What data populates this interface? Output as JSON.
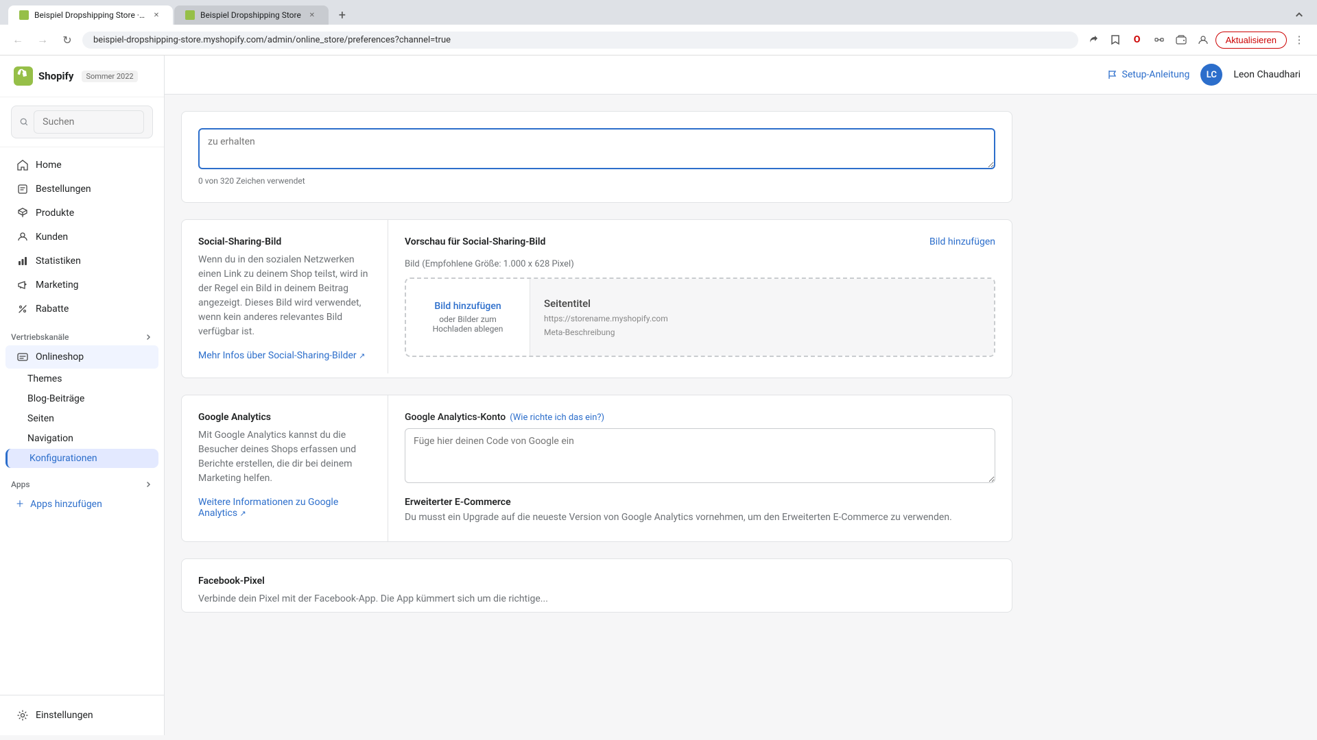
{
  "browser": {
    "tabs": [
      {
        "id": "tab1",
        "title": "Beispiel Dropshipping Store ·...",
        "active": true
      },
      {
        "id": "tab2",
        "title": "Beispiel Dropshipping Store",
        "active": false
      }
    ],
    "address": "beispiel-dropshipping-store.myshopify.com/admin/online_store/preferences?channel=true",
    "update_btn": "Aktualisieren"
  },
  "topbar": {
    "setup_label": "Setup-Anleitung",
    "user_initials": "LC",
    "user_name": "Leon Chaudhari"
  },
  "sidebar": {
    "logo": "Shopify",
    "season": "Sommer 2022",
    "search_placeholder": "Suchen",
    "nav_items": [
      {
        "id": "home",
        "label": "Home",
        "icon": "home"
      },
      {
        "id": "orders",
        "label": "Bestellungen",
        "icon": "orders"
      },
      {
        "id": "products",
        "label": "Produkte",
        "icon": "products"
      },
      {
        "id": "customers",
        "label": "Kunden",
        "icon": "customers"
      },
      {
        "id": "analytics",
        "label": "Statistiken",
        "icon": "analytics"
      },
      {
        "id": "marketing",
        "label": "Marketing",
        "icon": "marketing"
      },
      {
        "id": "discounts",
        "label": "Rabatte",
        "icon": "discounts"
      }
    ],
    "sales_channels_label": "Vertriebskanäle",
    "online_store_label": "Onlineshop",
    "sub_nav": [
      {
        "id": "themes",
        "label": "Themes"
      },
      {
        "id": "blog",
        "label": "Blog-Beiträge"
      },
      {
        "id": "pages",
        "label": "Seiten"
      },
      {
        "id": "navigation",
        "label": "Navigation"
      },
      {
        "id": "konfigurationen",
        "label": "Konfigurationen",
        "active": true
      }
    ],
    "apps_label": "Apps",
    "add_apps_label": "Apps hinzufügen",
    "settings_label": "Einstellungen"
  },
  "social_sharing": {
    "left_title": "Social-Sharing-Bild",
    "left_desc": "Wenn du in den sozialen Netzwerken einen Link zu deinem Shop teilst, wird in der Regel ein Bild in deinem Beitrag angezeigt. Dieses Bild wird verwendet, wenn kein anderes relevantes Bild verfügbar ist.",
    "left_link_text": "Mehr Infos über Social-Sharing-Bilder",
    "right_title": "Vorschau für Social-Sharing-Bild",
    "add_image_label": "Bild hinzufügen",
    "image_label": "Bild",
    "image_size_hint": "(Empfohlene Größe: 1.000 x 628 Pixel)",
    "upload_btn_label": "Bild hinzufügen",
    "upload_or": "oder Bilder zum Hochladen ablegen",
    "preview_title": "Seitentitel",
    "preview_url": "https://storename.myshopify.com",
    "preview_desc": "Meta-Beschreibung"
  },
  "meta_desc": {
    "char_count": "0 von 320 Zeichen verwendet",
    "placeholder": "zu erhalten"
  },
  "google_analytics": {
    "left_title": "Google Analytics",
    "left_desc": "Mit Google Analytics kannst du die Besucher deines Shops erfassen und Berichte erstellen, die dir bei deinem Marketing helfen.",
    "left_link_text": "Weitere Informationen zu Google Analytics",
    "field_label": "Google Analytics-Konto",
    "field_link_text": "Wie richte ich das ein?",
    "textarea_placeholder": "Füge hier deinen Code von Google ein",
    "ecommerce_title": "Erweiterter E-Commerce",
    "ecommerce_desc": "Du musst ein Upgrade auf die neueste Version von Google Analytics vornehmen, um den Erweiterten E-Commerce zu verwenden."
  }
}
